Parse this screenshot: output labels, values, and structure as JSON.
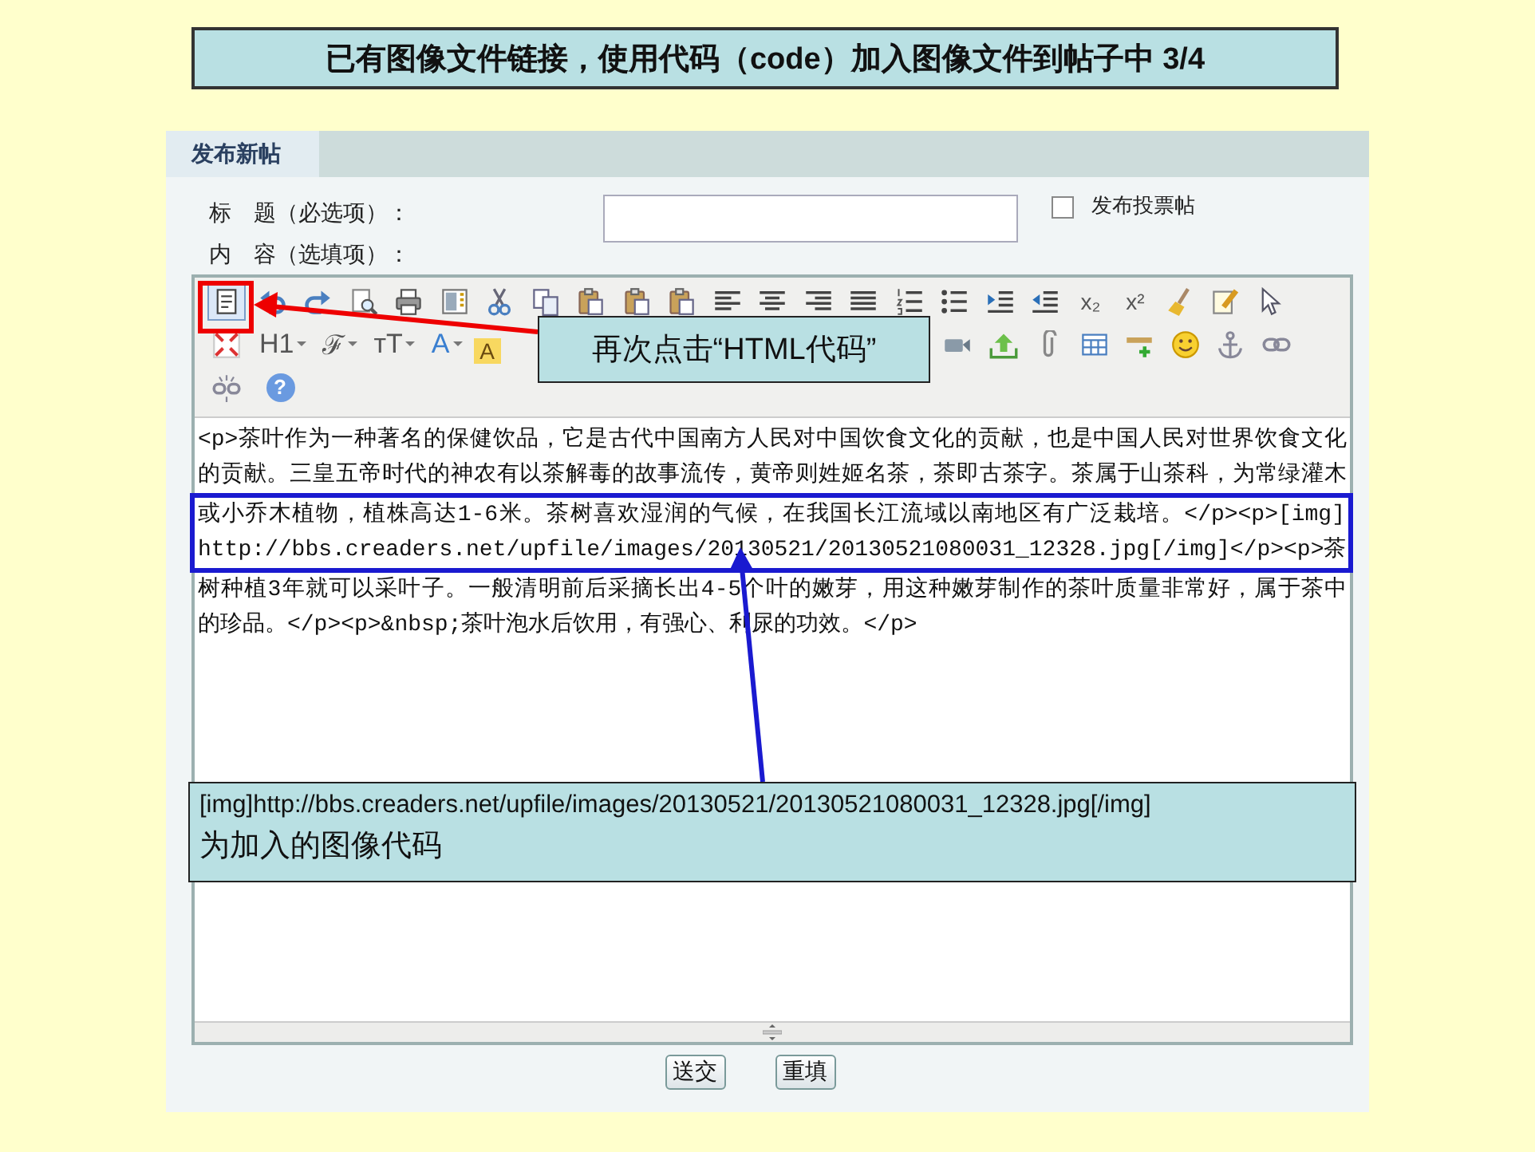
{
  "slide": {
    "title": "已有图像文件链接，使用代码（code）加入图像文件到帖子中 3/4"
  },
  "form": {
    "tab": {
      "label": "发布新帖",
      "selected": true
    },
    "title_label": "标　题（必选项）：",
    "poll": {
      "label": "发布投票帖",
      "checked": false
    },
    "content_label": "内　容（选填项）：",
    "toolbar": [
      [
        {
          "kind": "icon",
          "active": true
        },
        {
          "kind": "icon",
          "active": false
        },
        {
          "kind": "icon",
          "active": false
        },
        {
          "kind": "icon",
          "active": false
        },
        {
          "kind": "icon",
          "active": false
        },
        {
          "kind": "icon",
          "active": false
        },
        {
          "kind": "icon",
          "active": false
        },
        {
          "kind": "icon",
          "active": false
        },
        {
          "kind": "icon",
          "active": false
        },
        {
          "kind": "icon",
          "active": false
        },
        {
          "kind": "icon",
          "active": false
        },
        {
          "kind": "icon",
          "active": false
        },
        {
          "kind": "icon",
          "active": false
        },
        {
          "kind": "icon",
          "active": false
        },
        {
          "kind": "icon",
          "active": false
        },
        {
          "kind": "icon",
          "active": false
        },
        {
          "kind": "icon",
          "active": false
        },
        {
          "kind": "icon",
          "active": false
        },
        {
          "kind": "icon",
          "active": false
        },
        {
          "kind": "text",
          "label": "x₂",
          "active": false
        },
        {
          "kind": "text",
          "label": "x²",
          "active": false
        },
        {
          "kind": "icon",
          "active": false
        },
        {
          "kind": "icon",
          "active": false
        },
        {
          "kind": "icon",
          "active": false
        }
      ],
      [
        {
          "kind": "icon",
          "active": false
        },
        {
          "kind": "menu",
          "label": "H1",
          "active": false
        },
        {
          "kind": "menu",
          "label": "ℱ",
          "active": false
        },
        {
          "kind": "menu",
          "label": "ᴛT",
          "active": false
        },
        {
          "kind": "menu",
          "label": "A",
          "active": false
        },
        {
          "kind": "highlight",
          "label": "A",
          "active": false
        },
        {
          "kind": "icon",
          "active": false
        },
        {
          "kind": "icon",
          "active": false
        },
        {
          "kind": "icon",
          "active": false
        },
        {
          "kind": "icon",
          "active": false
        },
        {
          "kind": "icon",
          "active": false
        },
        {
          "kind": "icon",
          "active": false
        },
        {
          "kind": "icon",
          "active": false
        },
        {
          "kind": "icon",
          "active": false
        }
      ],
      [
        {
          "kind": "icon",
          "active": false
        },
        {
          "kind": "badge",
          "label": "?",
          "active": false
        }
      ]
    ],
    "editor_lines": [
      "<p>茶叶作为一种著名的保健饮品，它是古代中国南方人民对中国饮食文化的贡献，也是中国人民对世界饮食文化",
      "的贡献。三皇五帝时代的神农有以茶解毒的故事流传，黄帝则姓姬名茶，茶即古茶字。茶属于山茶科，为常绿灌木",
      "或小乔木植物，植株高达1-6米。茶树喜欢湿润的气候，在我国长江流域以南地区有广泛栽培。</p><p>[img]",
      "http://bbs.creaders.net/upfile/images/20130521/20130521080031_12328.jpg[/img]</p><p>茶",
      "树种植3年就可以采叶子。一般清明前后采摘长出4-5个叶的嫩芽，用这种嫩芽制作的茶叶质量非常好，属于茶中",
      "的珍品。</p><p>&nbsp;茶叶泡水后饮用，有强心、利尿的功效。</p>"
    ],
    "buttons": [
      "送交",
      "重填"
    ]
  },
  "annotations": [
    {
      "kind": "callout",
      "lines": [
        "再次点击“HTML代码”"
      ]
    },
    {
      "kind": "callout",
      "lines": [
        "[img]http://bbs.creaders.net/upfile/images/20130521/20130521080031_12328.jpg[/img]",
        "为加入的图像代码"
      ]
    }
  ]
}
